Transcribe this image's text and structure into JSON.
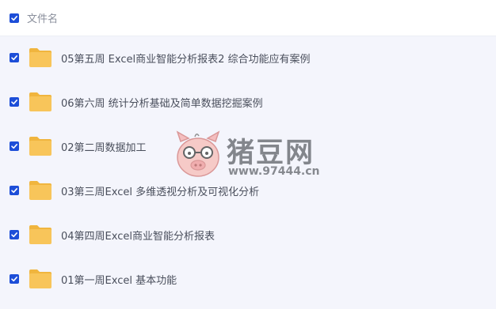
{
  "header": {
    "column_label": "文件名",
    "select_all_checked": true
  },
  "files": [
    {
      "name": "05第五周 Excel商业智能分析报表2 综合功能应有案例",
      "checked": true
    },
    {
      "name": "06第六周 统计分析基础及简单数据挖掘案例",
      "checked": true
    },
    {
      "name": "02第二周数据加工",
      "checked": true
    },
    {
      "name": "03第三周Excel 多维透视分析及可视化分析",
      "checked": true
    },
    {
      "name": "04第四周Excel商业智能分析报表",
      "checked": true
    },
    {
      "name": "01第一周Excel 基本功能",
      "checked": true
    }
  ],
  "watermark": {
    "title": "猪豆网",
    "url": "www.97444.cn"
  },
  "colors": {
    "checkbox": "#1d4ed8",
    "folder": "#f8c55a",
    "folder_tab": "#f0b53e",
    "row_bg": "#f4f5fc"
  },
  "icons": {
    "checkbox": "checkmark-icon",
    "folder": "folder-icon",
    "watermark_logo": "pig-logo-icon"
  }
}
